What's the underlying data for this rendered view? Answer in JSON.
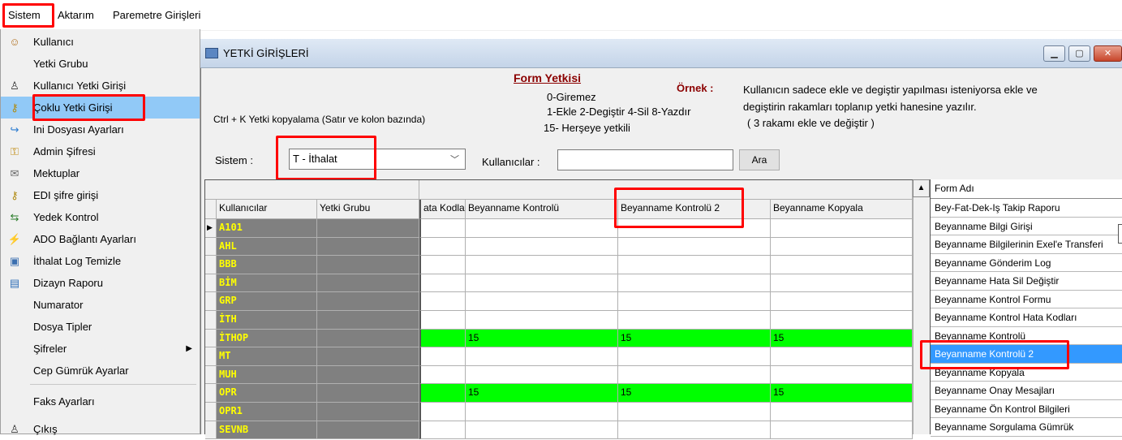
{
  "menubar": {
    "items": [
      "Sistem",
      "Aktarım",
      "Paremetre Girişleri"
    ]
  },
  "sistem_menu": {
    "items": [
      {
        "label": "Kullanıcı",
        "icon": "user-icon"
      },
      {
        "label": "Yetki Grubu",
        "icon": ""
      },
      {
        "label": "Kullanıcı Yetki Girişi",
        "icon": "person-icon"
      },
      {
        "label": "Çoklu Yetki Girişi",
        "icon": "keys-icon"
      },
      {
        "label": "Ini Dosyası  Ayarları",
        "icon": "arrow-icon"
      },
      {
        "label": "Admin Şifresi",
        "icon": "key-icon"
      },
      {
        "label": "Mektuplar",
        "icon": "envelope-icon"
      },
      {
        "label": "EDI şifre girişi",
        "icon": "keys-icon"
      },
      {
        "label": "Yedek Kontrol",
        "icon": "backup-icon"
      },
      {
        "label": "ADO Bağlantı Ayarları",
        "icon": "connection-icon"
      },
      {
        "label": "İthalat Log Temizle",
        "icon": "clean-icon"
      },
      {
        "label": "Dizayn Raporu",
        "icon": "report-icon"
      },
      {
        "label": "Numarator",
        "icon": ""
      },
      {
        "label": "Dosya Tipler",
        "icon": ""
      },
      {
        "label": "Şifreler",
        "icon": ""
      },
      {
        "label": "Cep Gümrük Ayarlar",
        "icon": ""
      },
      {
        "label": "Faks Ayarları",
        "icon": ""
      },
      {
        "label": "Çıkış",
        "icon": "exit-icon"
      }
    ]
  },
  "window": {
    "title": "YETKİ GİRİŞLERİ",
    "form_yetkisi": "Form Yetkisi",
    "levels": [
      "0-Giremez",
      "1-Ekle  2-Degiştir  4-Sil  8-Yazdır",
      "15- Herşeye yetkili"
    ],
    "ornek_label": "Örnek :",
    "ornek_lines": [
      "Kullanıcın sadece ekle ve degiştir yapılması isteniyorsa  ekle ve",
      "degiştirin rakamları toplanıp yetki hanesine yazılır.",
      "( 3 rakamı ekle ve değiştir )"
    ],
    "ctrl_hint": "Ctrl + K Yetki kopyalama (Satır ve kolon bazında)",
    "sistem_label": "Sistem :",
    "sistem_value": "T - İthalat",
    "kullanicilar_label": "Kullanıcılar :",
    "kullanicilar_value": "",
    "ara": "Ara"
  },
  "grid": {
    "columns": [
      "Kullanıcılar",
      "Yetki Grubu",
      "ata Kodla",
      "Beyanname Kontrolü",
      "Beyanname Kontrolü 2",
      "Beyanname Kopyala"
    ],
    "rows": [
      {
        "user": "A101",
        "values": [
          "",
          "",
          "",
          ""
        ],
        "green": false
      },
      {
        "user": "AHL",
        "values": [
          "",
          "",
          "",
          ""
        ],
        "green": false
      },
      {
        "user": "BBB",
        "values": [
          "",
          "",
          "",
          ""
        ],
        "green": false
      },
      {
        "user": "BİM",
        "values": [
          "",
          "",
          "",
          ""
        ],
        "green": false
      },
      {
        "user": "GRP",
        "values": [
          "",
          "",
          "",
          ""
        ],
        "green": false
      },
      {
        "user": "İTH",
        "values": [
          "",
          "",
          "",
          ""
        ],
        "green": false
      },
      {
        "user": "İTHOP",
        "values": [
          "",
          "15",
          "15",
          "15"
        ],
        "green": true
      },
      {
        "user": "MT",
        "values": [
          "",
          "",
          "",
          ""
        ],
        "green": false
      },
      {
        "user": "MUH",
        "values": [
          "",
          "",
          "",
          ""
        ],
        "green": false
      },
      {
        "user": "OPR",
        "values": [
          "",
          "15",
          "15",
          "15"
        ],
        "green": true
      },
      {
        "user": "OPR1",
        "values": [
          "",
          "",
          "",
          ""
        ],
        "green": false
      },
      {
        "user": "SEVNB",
        "values": [
          "",
          "",
          "",
          ""
        ],
        "green": false
      }
    ]
  },
  "form_list": {
    "header": "Form Adı",
    "items": [
      "Bey-Fat-Dek-Iş Takip Raporu",
      "Beyanname Bilgi Girişi",
      "Beyanname Bilgilerinin Exel'e Transferi",
      "Beyanname Gönderim Log",
      "Beyanname Hata Sil Değiştir",
      "Beyanname Kontrol Formu",
      "Beyanname Kontrol Hata Kodları",
      "Beyanname Kontrolü",
      "Beyanname Kontrolü 2",
      "Beyanname Kopyala",
      "Beyanname Onay Mesajları",
      "Beyanname Ön Kontrol Bilgileri",
      "Beyanname Sorgulama Gümrük"
    ],
    "selected_index": 8
  },
  "colors": {
    "highlight": "#ff0000",
    "green_row": "#00ff00",
    "user_cell": "#808080",
    "selected": "#3399ff",
    "menu_selected": "#91c9f7"
  }
}
